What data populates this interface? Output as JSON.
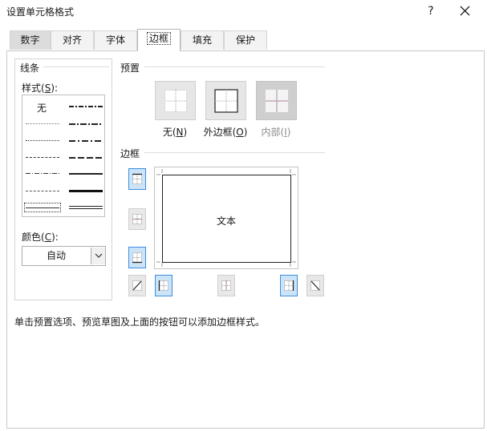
{
  "window": {
    "title": "设置单元格格式",
    "help_label": "?"
  },
  "tabs": [
    {
      "label": "数字"
    },
    {
      "label": "对齐"
    },
    {
      "label": "字体"
    },
    {
      "label": "边框",
      "active": true
    },
    {
      "label": "填充"
    },
    {
      "label": "保护"
    }
  ],
  "line": {
    "group_title": "线条",
    "style_label_pre": "样式(",
    "style_label_key": "S",
    "style_label_post": "):",
    "none_label": "无",
    "color_label_pre": "颜色(",
    "color_label_key": "C",
    "color_label_post": "):",
    "color_value": "自动"
  },
  "presets": {
    "section_title": "预置",
    "items": [
      {
        "label_pre": "无(",
        "key": "N",
        "label_post": ")",
        "icon": "preset-none-icon",
        "enabled": true
      },
      {
        "label_pre": "外边框(",
        "key": "O",
        "label_post": ")",
        "icon": "preset-outline-icon",
        "enabled": true
      },
      {
        "label_pre": "内部(",
        "key": "I",
        "label_post": ")",
        "icon": "preset-inside-icon",
        "enabled": false
      }
    ]
  },
  "border": {
    "section_title": "边框",
    "preview_text": "文本",
    "hint": "单击预置选项、预览草图及上面的按钮可以添加边框样式。"
  },
  "colors": {
    "active_blue": "#3c8dde",
    "active_fill": "#cce4f7",
    "disabled_text": "#8c8c8c"
  }
}
